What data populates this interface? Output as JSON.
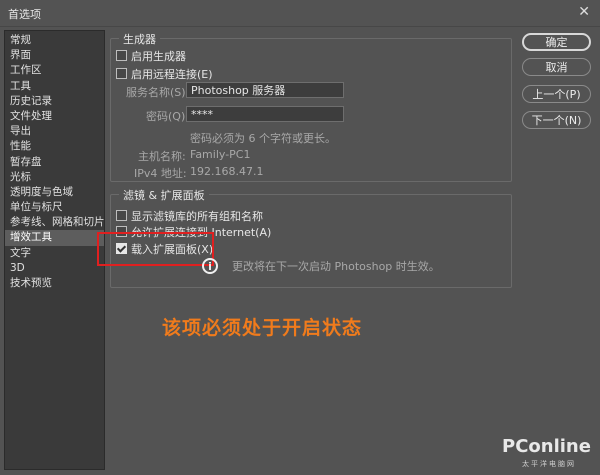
{
  "window": {
    "title": "首选项",
    "close_glyph": "✕"
  },
  "sidebar": {
    "items": [
      {
        "label": "常规",
        "selected": false
      },
      {
        "label": "界面",
        "selected": false
      },
      {
        "label": "工作区",
        "selected": false
      },
      {
        "label": "工具",
        "selected": false
      },
      {
        "label": "历史记录",
        "selected": false
      },
      {
        "label": "文件处理",
        "selected": false
      },
      {
        "label": "导出",
        "selected": false
      },
      {
        "label": "性能",
        "selected": false
      },
      {
        "label": "暂存盘",
        "selected": false
      },
      {
        "label": "光标",
        "selected": false
      },
      {
        "label": "透明度与色域",
        "selected": false
      },
      {
        "label": "单位与标尺",
        "selected": false
      },
      {
        "label": "参考线、网格和切片",
        "selected": false
      },
      {
        "label": "增效工具",
        "selected": true
      },
      {
        "label": "文字",
        "selected": false
      },
      {
        "label": "3D",
        "selected": false
      },
      {
        "label": "技术预览",
        "selected": false
      }
    ]
  },
  "generator": {
    "legend": "生成器",
    "enable_generator": "启用生成器",
    "enable_remote": "启用远程连接(E)",
    "service_name_label": "服务名称(S):",
    "service_name_value": "Photoshop 服务器",
    "password_label": "密码(Q):",
    "password_value": "****",
    "password_hint": "密码必须为 6 个字符或更长。",
    "host_label": "主机名称:",
    "host_value": "Family-PC1",
    "ipv4_label": "IPv4 地址:",
    "ipv4_value": "192.168.47.1"
  },
  "filters": {
    "legend": "滤镜 & 扩展面板",
    "show_all": "显示滤镜库的所有组和名称",
    "allow_internet": "允许扩展连接到 Internet(A)",
    "load_panels": "载入扩展面板(X)",
    "restart_note": "更改将在下一次启动 Photoshop 时生效。"
  },
  "buttons": {
    "ok": "确定",
    "cancel": "取消",
    "prev": "上一个(P)",
    "next": "下一个(N)"
  },
  "annotation": "该项必须处于开启状态",
  "watermark": {
    "brand": "PConline",
    "sub": "太平洋电脑网"
  },
  "colors": {
    "annotation": "#f07b1c",
    "highlight_box": "#e02020",
    "background": "#535353"
  }
}
